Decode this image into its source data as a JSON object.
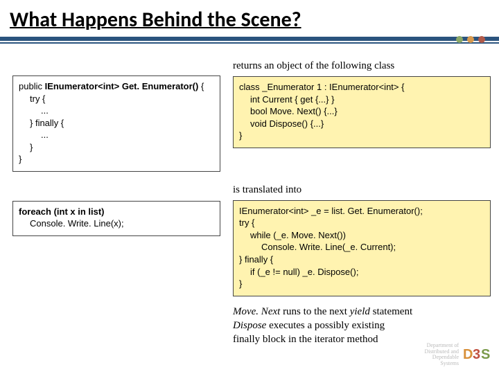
{
  "title": "What Happens Behind the Scene?",
  "captions": {
    "returns": "returns an object of the following class",
    "translated": "is translated into"
  },
  "code": {
    "getEnum": {
      "l1a": "public ",
      "l1b": "IEnumerator<int> Get. Enumerator()",
      "l1c": " {",
      "l2": "try {",
      "l3": "...",
      "l4": "} finally {",
      "l5": "...",
      "l6": "}",
      "l7": "}"
    },
    "enumClass": {
      "l1": "class _Enumerator 1 : IEnumerator<int> {",
      "l2": "int Current { get {...} }",
      "l3": "bool Move. Next() {...}",
      "l4": "void Dispose() {...}",
      "l5": "}"
    },
    "foreach": {
      "l1": "foreach (int x in list)",
      "l2": "Console. Write. Line(x);"
    },
    "expanded": {
      "l1": "IEnumerator<int> _e = list. Get. Enumerator();",
      "l2": "try {",
      "l3": "while (_e. Move. Next())",
      "l4": "Console. Write. Line(_e. Current);",
      "l5": "} finally {",
      "l6": "if (_e != null) _e. Dispose();",
      "l7": "}"
    }
  },
  "notes": {
    "mn1": "Move. Next",
    "mn2": " runs to the next ",
    "mn3": "yield",
    "mn4": " statement",
    "d1": "Dispose",
    "d2": " executes a possibly existing",
    "d3": "finally block in the iterator method"
  },
  "footer": {
    "dept": "Department of\nDistributed and\nDependable\nSystems"
  }
}
